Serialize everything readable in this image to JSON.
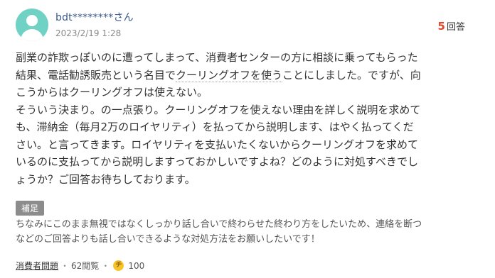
{
  "user": {
    "name": "bdt********さん",
    "date": "2023/2/19 1:28"
  },
  "answers": {
    "count": "5",
    "suffix": "回答"
  },
  "question": {
    "text_before": "副業の詐欺っぽいのに遭ってしまって、消費者センターの方に相談に乗ってもらった\n結果、電話勧誘販売という名目で",
    "highlight": "クーリングオフを使う",
    "text_after": "ことにしました。ですが、向\nこうからはクーリングオフは使えない。\nそういう決まり。の一点張り。クーリングオフを使えない理由を詳しく説明を求めて\nも、滞納金（毎月2万のロイヤリティ）を払ってから説明します、はやく払ってくだ\nさい。と言ってきます。ロイヤリティを支払いたくないからクーリングオフを求めて\nいるのに支払ってから説明しますっておかしいですよね？どのように対処すべきでし\nょうか？ご回答お待ちしております。"
  },
  "supplement": {
    "label": "補足",
    "text": "ちなみにこのまま無視ではなくしっかり話し合いで終わらせた終わり方をしたいため、連絡を断つ\nなどのご回答よりも話し合いできるような対処方法をお願いしたいです！"
  },
  "footer": {
    "category": "消費者問題",
    "questions": "62閲覧",
    "coin_icon": "チ",
    "coins": "100"
  },
  "colors": {
    "avatar": "#6fd2c4",
    "answer_count": "#e2452a",
    "username": "#3a5a8c",
    "coin": "#f6c42a"
  }
}
